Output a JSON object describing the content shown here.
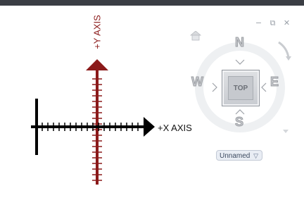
{
  "viewport": {
    "x_axis_label": "+X AXIS",
    "y_axis_label": "+Y AXIS"
  },
  "window_controls": {
    "minimize": "−",
    "restore": "⧉",
    "close": "✕"
  },
  "viewcube": {
    "face_label": "TOP",
    "north": "N",
    "south": "S",
    "east": "E",
    "west": "W"
  },
  "wcs_menu": {
    "value": "Unnamed"
  },
  "colors": {
    "x_axis": "#000000",
    "y_axis": "#8b1a1a",
    "titlebar": "#3b3e44",
    "viewcube": "#c9cbcf"
  }
}
